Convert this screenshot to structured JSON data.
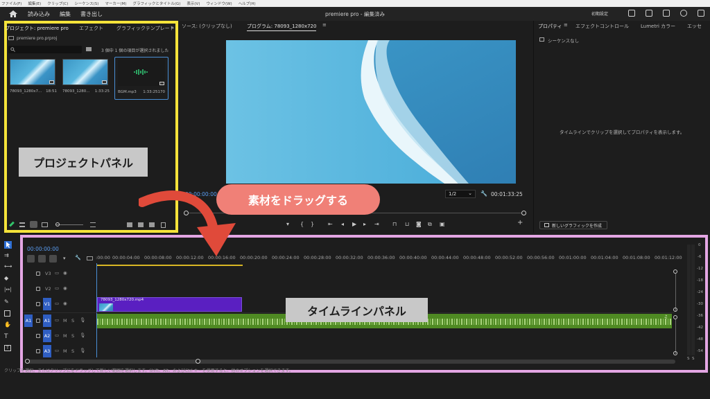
{
  "menubar": [
    "ファイル(F)",
    "編集(E)",
    "クリップ(C)",
    "シーケンス(S)",
    "マーカー(M)",
    "グラフィックとタイトル(G)",
    "表示(V)",
    "ウィンドウ(W)",
    "ヘルプ(H)"
  ],
  "header": {
    "tabs": [
      "読み込み",
      "編集",
      "書き出し"
    ],
    "title": "premiere pro - 編集済み",
    "workspace": "初期設定"
  },
  "project": {
    "tabs": [
      "プロジェクト: premiere pro",
      "エフェクト",
      "グラフィックテンプレート"
    ],
    "file": "premiere pro.prproj",
    "selection_info": "3 個中 1 個の項目が選択されました",
    "items": [
      {
        "name": "78093_1280x7...",
        "duration": "18:51"
      },
      {
        "name": "78093_1280...",
        "duration": "1:33:25"
      },
      {
        "name": "BGM.mp3",
        "duration": "1:33:25170"
      }
    ],
    "overlay_label": "プロジェクトパネル"
  },
  "source": {
    "tab": "ソース: (クリップなし)"
  },
  "program": {
    "tab": "プログラム: 78093_1280x720",
    "timecode": "00:00:00:00",
    "zoom": "1/2",
    "duration": "00:01:33:25"
  },
  "properties": {
    "tabs": [
      "プロパティ",
      "エフェクトコントロール",
      "Lumetri カラー",
      "エッセ"
    ],
    "sequence_status": "シーケンスなし",
    "empty_message": "タイムラインでクリップを選択してプロパティを表示します。",
    "new_graphic_button": "新しいグラフィックを作成"
  },
  "callout": {
    "text": "素材をドラッグする",
    "color": "#f08077",
    "arrow_color": "#e04a3a"
  },
  "timeline": {
    "timecode": "00:00:00:00",
    "ruler": [
      ":00:00",
      "00:00:04:00",
      "00:00:08:00",
      "00:00:12:00",
      "00:00:16:00",
      "00:00:20:00",
      "00:00:24:00",
      "00:00:28:00",
      "00:00:32:00",
      "00:00:36:00",
      "00:00:40:00",
      "00:00:44:00",
      "00:00:48:00",
      "00:00:52:00",
      "00:00:56:00",
      "00:01:00:00",
      "00:01:04:00",
      "00:01:08:00",
      "00:01:12:00"
    ],
    "tracks": [
      {
        "name": "V3",
        "controls": [
          "▭",
          "◉"
        ]
      },
      {
        "name": "V2",
        "controls": [
          "▭",
          "◉"
        ]
      },
      {
        "name": "V1",
        "controls": [
          "▭",
          "◉"
        ]
      },
      {
        "name": "A1",
        "controls": [
          "M",
          "S",
          "🎙"
        ]
      },
      {
        "name": "A2",
        "controls": [
          "M",
          "S",
          "🎙"
        ]
      },
      {
        "name": "A3",
        "controls": [
          "M",
          "S",
          "🎙"
        ]
      }
    ],
    "source_patch": "A1",
    "video_clip": "78093_1280x720.mp4",
    "overlay_label": "タイムラインパネル",
    "status": "クリップを選択。またはクリップにをドラッグして新しい範囲を選択します。Shift、Alt、およびCtrl キーを使用すると、他のオプションを選択できます。"
  },
  "meter": {
    "scale": [
      "0",
      "-6",
      "-12",
      "-18",
      "-24",
      "-30",
      "-36",
      "-42",
      "-48",
      "-54"
    ],
    "footer": [
      "S",
      "S"
    ]
  },
  "colors": {
    "project_highlight": "#f5e33a",
    "timeline_highlight": "#e4a6e4",
    "video_clip": "#5a1fc1",
    "audio_clip": "#4f8a23"
  }
}
